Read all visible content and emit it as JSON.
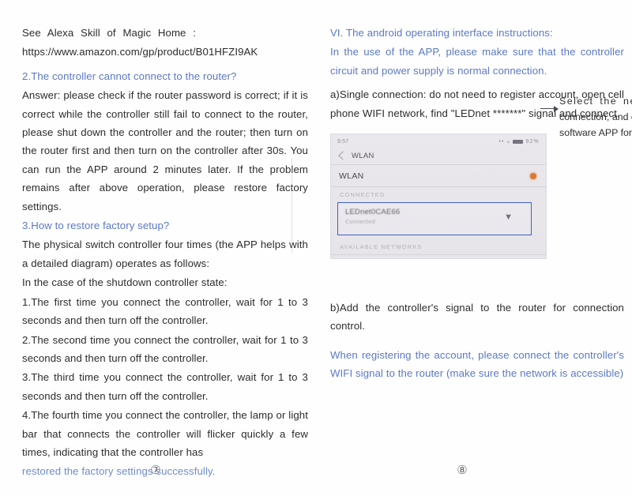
{
  "document": {
    "type": "product-manual-scan",
    "colors": {
      "ink_black": "#2c2c2e",
      "ink_blue": "#5b79c4",
      "highlight_box_blue": "#3355c9",
      "toggle_orange": "#e2711d",
      "page_background": "#fefefe"
    }
  },
  "left_column": {
    "alexa_heading": "See Alexa Skill of Magic Home :",
    "alexa_url": "https://www.amazon.com/gp/product/B01HFZI9AK",
    "q2_heading": "2.The controller cannot connect to the router?",
    "q2_answer": "Answer: please check if the router password is correct; if it is correct while the controller still fail to connect to the router, please shut down the controller and the router; then turn on the router first and then turn on the controller after 30s. You can run the APP around 2 minutes later. If the problem remains after above operation, please restore factory settings.",
    "q3_heading": "3.How to restore factory setup?",
    "q3_intro": "The physical switch controller four times (the APP helps with a detailed diagram) operates as follows:",
    "q3_state": "In the case of the shutdown controller state:",
    "steps": [
      "1.The first time you connect the controller, wait for 1 to 3 seconds and then turn off the controller.",
      "2.The second time you connect the controller, wait for 1 to 3 seconds and then turn off the controller.",
      "3.The third time you connect the controller, wait for 1 to 3 seconds and then turn off the controller.",
      "4.The fourth time you connect the controller, the lamp or light bar that connects the controller will flicker quickly a few times, indicating that the controller has"
    ],
    "q3_closing_blue": "restored the factory settings successfully.",
    "page_number": "⑦"
  },
  "right_column": {
    "section_heading": "VI. The android operating interface instructions:",
    "section_intro": "In the use of the APP, please make sure that the controller circuit and power supply is normal connection.",
    "item_a": "a)Single connection: do not need to register account, open cell phone WIFI network, find \"LEDnet *******\" signal and connect.",
    "phone_screenshot": {
      "status_time": "9:57",
      "status_battery": "92%",
      "nav_title": "WLAN",
      "wlan_toggle_label": "WLAN",
      "wlan_toggle_state": "on",
      "section_connected": "CONNECTED",
      "section_available": "AVAILABLE NETWORKS",
      "connected_network": {
        "ssid": "LEDnet0CAE66",
        "status": "Connected",
        "signal_icon": "wifi-icon"
      }
    },
    "callout": {
      "line1": "Select the network",
      "line2": "connection, and open the",
      "line3": "software APP for use"
    },
    "item_b": "b)Add the controller's signal to the router for connection control.",
    "closing_blue": "When registering the account, please connect the controller's WIFI signal to the router (make sure the network is accessible)",
    "page_number": "⑧"
  }
}
